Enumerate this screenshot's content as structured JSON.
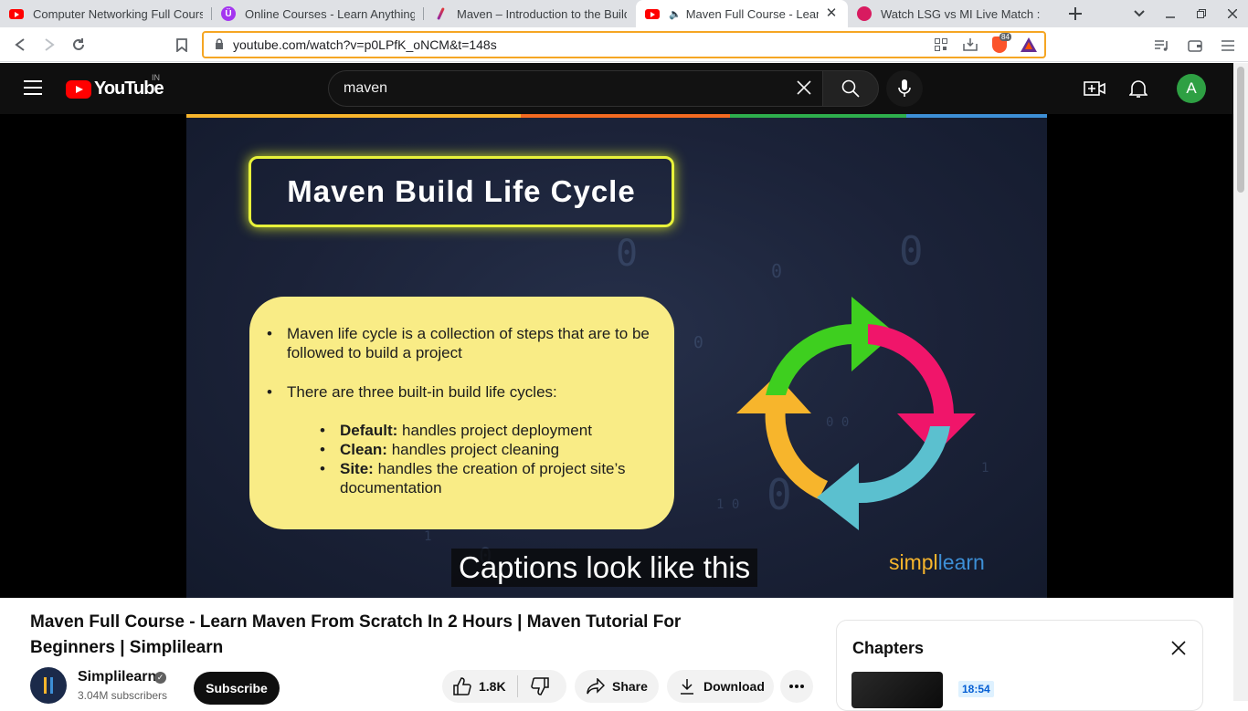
{
  "browser": {
    "tabs": [
      {
        "title": "Computer Networking Full Course",
        "icon": "youtube-icon"
      },
      {
        "title": "Online Courses - Learn Anything",
        "icon": "udemy-icon"
      },
      {
        "title": "Maven – Introduction to the Build",
        "icon": "feather-icon"
      },
      {
        "title": "Maven Full Course - Learn Maven",
        "icon": "youtube-icon",
        "active": true,
        "audio": true
      },
      {
        "title": "Watch LSG vs MI Live Match :",
        "icon": "hotstar-icon"
      }
    ],
    "url": "youtube.com/watch?v=p0LPfK_oNCM&t=148s",
    "brave_badge": "84"
  },
  "youtube": {
    "logo_text": "YouTube",
    "country": "IN",
    "search_value": "maven",
    "avatar_letter": "A"
  },
  "slide": {
    "title": "Maven Build Life Cycle",
    "bullet1": "Maven life cycle is a collection of steps that are to be followed to build a project",
    "bullet2": "There are three built-in build life cycles:",
    "sub": [
      {
        "term": "Default:",
        "text": " handles project deployment"
      },
      {
        "term": "Clean:",
        "text": " handles project cleaning"
      },
      {
        "term": "Site:",
        "text": " handles the creation of project site’s documentation"
      }
    ],
    "brand_a": "simpl",
    "brand_b": "learn",
    "caption": "Captions look like this"
  },
  "video": {
    "title": "Maven Full Course - Learn Maven From Scratch In 2 Hours | Maven Tutorial For Beginners | Simplilearn",
    "channel": "Simplilearn",
    "subscribers": "3.04M subscribers",
    "subscribe_label": "Subscribe",
    "likes": "1.8K",
    "share_label": "Share",
    "download_label": "Download"
  },
  "chapters": {
    "title": "Chapters",
    "first_time": "18:54"
  },
  "colors": {
    "yt_red": "#ff0000",
    "card_yellow": "#f9ec86",
    "title_glow": "#e8f23a",
    "arrow_green": "#3ecf1f",
    "arrow_pink": "#f0156a",
    "arrow_blue": "#5bc0cf",
    "arrow_orange": "#f7b52c"
  }
}
